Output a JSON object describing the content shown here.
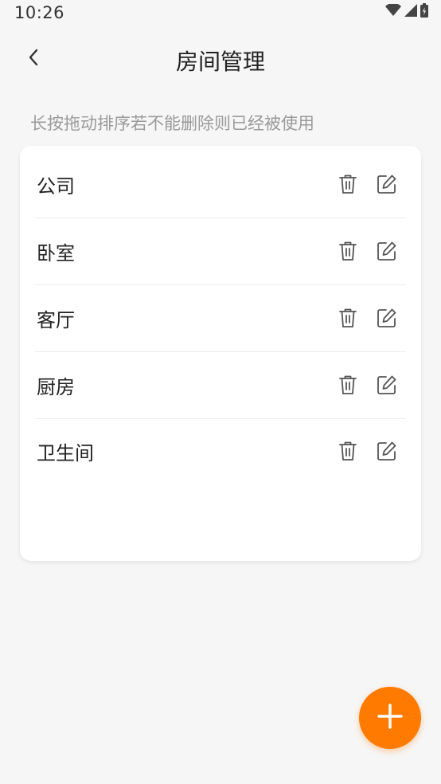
{
  "status_bar": {
    "time": "10:26",
    "icons": [
      "wifi-icon",
      "signal-icon",
      "battery-icon"
    ]
  },
  "header": {
    "title": "房间管理",
    "back_icon": "chevron-left-icon"
  },
  "hint": "长按拖动排序若不能删除则已经被使用",
  "rooms": [
    {
      "name": "公司"
    },
    {
      "name": "卧室"
    },
    {
      "name": "客厅"
    },
    {
      "name": "厨房"
    },
    {
      "name": "卫生间"
    }
  ],
  "row_actions": {
    "delete_icon": "trash-icon",
    "edit_icon": "edit-icon"
  },
  "fab": {
    "icon": "plus-icon"
  },
  "colors": {
    "accent": "#ff7a00",
    "background": "#f6f6f6",
    "card": "#ffffff",
    "hint_text": "#9a9a9a",
    "icon_gray": "#555555"
  }
}
